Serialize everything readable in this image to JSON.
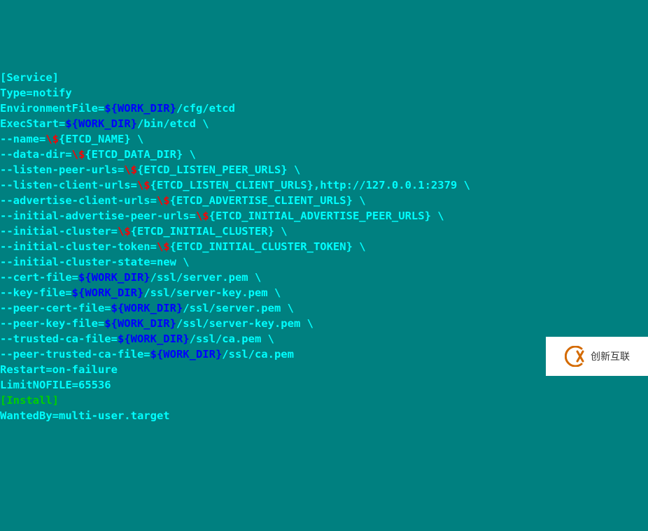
{
  "lines": [
    [
      {
        "c": "cy",
        "t": "[Service]"
      }
    ],
    [
      {
        "c": "cy",
        "t": "Type=notify"
      }
    ],
    [
      {
        "c": "cy",
        "t": "EnvironmentFile="
      },
      {
        "c": "bl",
        "t": "${WORK_DIR}"
      },
      {
        "c": "cy",
        "t": "/cfg/etcd"
      }
    ],
    [
      {
        "c": "cy",
        "t": "ExecStart="
      },
      {
        "c": "bl",
        "t": "${WORK_DIR}"
      },
      {
        "c": "cy",
        "t": "/bin/etcd \\"
      }
    ],
    [
      {
        "c": "cy",
        "t": "--name="
      },
      {
        "c": "rd",
        "t": "\\$"
      },
      {
        "c": "cy",
        "t": "{ETCD_NAME} \\"
      }
    ],
    [
      {
        "c": "cy",
        "t": "--data-dir="
      },
      {
        "c": "rd",
        "t": "\\$"
      },
      {
        "c": "cy",
        "t": "{ETCD_DATA_DIR} \\"
      }
    ],
    [
      {
        "c": "cy",
        "t": "--listen-peer-urls="
      },
      {
        "c": "rd",
        "t": "\\$"
      },
      {
        "c": "cy",
        "t": "{ETCD_LISTEN_PEER_URLS} \\"
      }
    ],
    [
      {
        "c": "cy",
        "t": "--listen-client-urls="
      },
      {
        "c": "rd",
        "t": "\\$"
      },
      {
        "c": "cy",
        "t": "{ETCD_LISTEN_CLIENT_URLS},http://127.0.0.1:2379 \\"
      }
    ],
    [
      {
        "c": "cy",
        "t": "--advertise-client-urls="
      },
      {
        "c": "rd",
        "t": "\\$"
      },
      {
        "c": "cy",
        "t": "{ETCD_ADVERTISE_CLIENT_URLS} \\"
      }
    ],
    [
      {
        "c": "cy",
        "t": "--initial-advertise-peer-urls="
      },
      {
        "c": "rd",
        "t": "\\$"
      },
      {
        "c": "cy",
        "t": "{ETCD_INITIAL_ADVERTISE_PEER_URLS} \\"
      }
    ],
    [
      {
        "c": "cy",
        "t": "--initial-cluster="
      },
      {
        "c": "rd",
        "t": "\\$"
      },
      {
        "c": "cy",
        "t": "{ETCD_INITIAL_CLUSTER} \\"
      }
    ],
    [
      {
        "c": "cy",
        "t": "--initial-cluster-token="
      },
      {
        "c": "rd",
        "t": "\\$"
      },
      {
        "c": "cy",
        "t": "{ETCD_INITIAL_CLUSTER_TOKEN} \\"
      }
    ],
    [
      {
        "c": "cy",
        "t": "--initial-cluster-state=new \\"
      }
    ],
    [
      {
        "c": "cy",
        "t": "--cert-file="
      },
      {
        "c": "bl",
        "t": "${WORK_DIR}"
      },
      {
        "c": "cy",
        "t": "/ssl/server.pem \\"
      }
    ],
    [
      {
        "c": "cy",
        "t": "--key-file="
      },
      {
        "c": "bl",
        "t": "${WORK_DIR}"
      },
      {
        "c": "cy",
        "t": "/ssl/server-key.pem \\"
      }
    ],
    [
      {
        "c": "cy",
        "t": "--peer-cert-file="
      },
      {
        "c": "bl",
        "t": "${WORK_DIR}"
      },
      {
        "c": "cy",
        "t": "/ssl/server.pem \\"
      }
    ],
    [
      {
        "c": "cy",
        "t": "--peer-key-file="
      },
      {
        "c": "bl",
        "t": "${WORK_DIR}"
      },
      {
        "c": "cy",
        "t": "/ssl/server-key.pem \\"
      }
    ],
    [
      {
        "c": "cy",
        "t": "--trusted-ca-file="
      },
      {
        "c": "bl",
        "t": "${WORK_DIR}"
      },
      {
        "c": "cy",
        "t": "/ssl/ca.pem \\"
      }
    ],
    [
      {
        "c": "cy",
        "t": "--peer-trusted-ca-file="
      },
      {
        "c": "bl",
        "t": "${WORK_DIR}"
      },
      {
        "c": "cy",
        "t": "/ssl/ca.pem"
      }
    ],
    [
      {
        "c": "cy",
        "t": "Restart=on-failure"
      }
    ],
    [
      {
        "c": "cy",
        "t": "LimitNOFILE=65536"
      }
    ],
    [
      {
        "c": "cy",
        "t": ""
      }
    ],
    [
      {
        "c": "grn",
        "t": "[Install]"
      }
    ],
    [
      {
        "c": "cy",
        "t": "WantedBy=multi-user.target"
      }
    ]
  ],
  "watermark": {
    "text": "创新互联"
  }
}
